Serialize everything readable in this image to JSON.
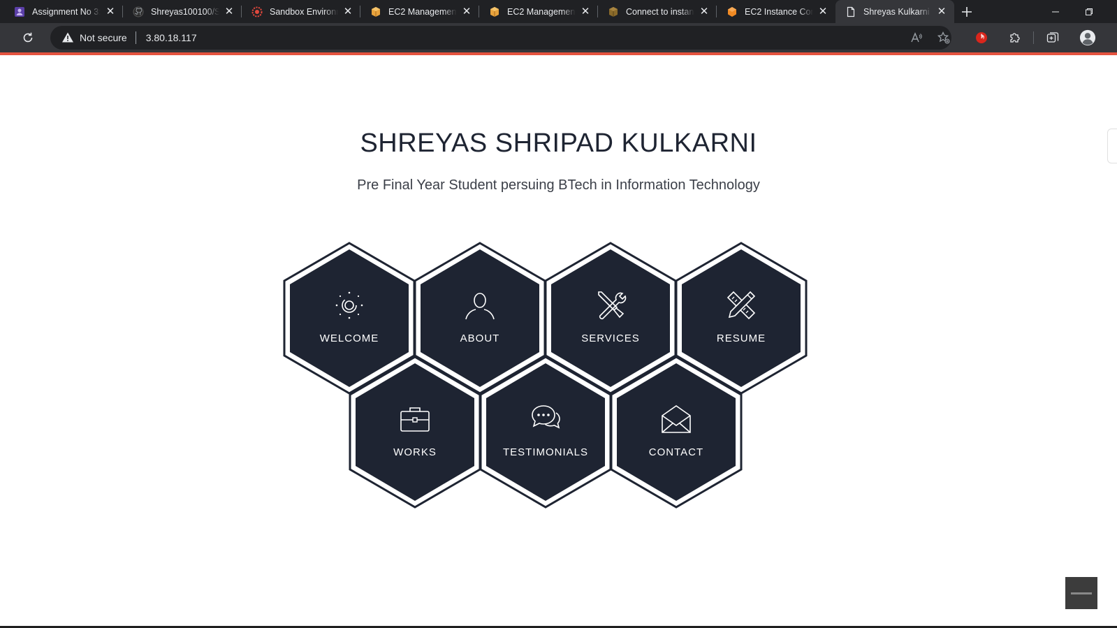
{
  "tabs": [
    {
      "title": "Assignment No 3: ",
      "favicon": "user-purple-icon"
    },
    {
      "title": "Shreyas100100/Sh",
      "favicon": "github-icon"
    },
    {
      "title": "Sandbox Environm",
      "favicon": "sandbox-gear-icon"
    },
    {
      "title": "EC2 Management",
      "favicon": "aws-box-icon"
    },
    {
      "title": "EC2 Management",
      "favicon": "aws-box-icon"
    },
    {
      "title": "Connect to instan",
      "favicon": "aws-box-icon"
    },
    {
      "title": "EC2 Instance Con",
      "favicon": "aws-hex-icon"
    },
    {
      "title": "Shreyas Kulkarni P",
      "favicon": "page-icon"
    }
  ],
  "address": {
    "security_label": "Not secure",
    "url": "3.80.18.117"
  },
  "page": {
    "name": "SHREYAS SHRIPAD KULKARNI",
    "tagline": "Pre Final Year Student persuing BTech in Information Technology"
  },
  "hexagons": [
    {
      "label": "WELCOME",
      "icon": "sun-spark-icon"
    },
    {
      "label": "ABOUT",
      "icon": "person-icon"
    },
    {
      "label": "SERVICES",
      "icon": "tools-icon"
    },
    {
      "label": "RESUME",
      "icon": "pencil-ruler-icon"
    },
    {
      "label": "WORKS",
      "icon": "briefcase-icon"
    },
    {
      "label": "TESTIMONIALS",
      "icon": "chat-bubbles-icon"
    },
    {
      "label": "CONTACT",
      "icon": "envelope-icon"
    }
  ],
  "colors": {
    "hex_fill": "#1e2432",
    "accent_loadbar": "#e5533f",
    "tab_bg": "#202124",
    "toolbar_bg": "#35363a"
  }
}
